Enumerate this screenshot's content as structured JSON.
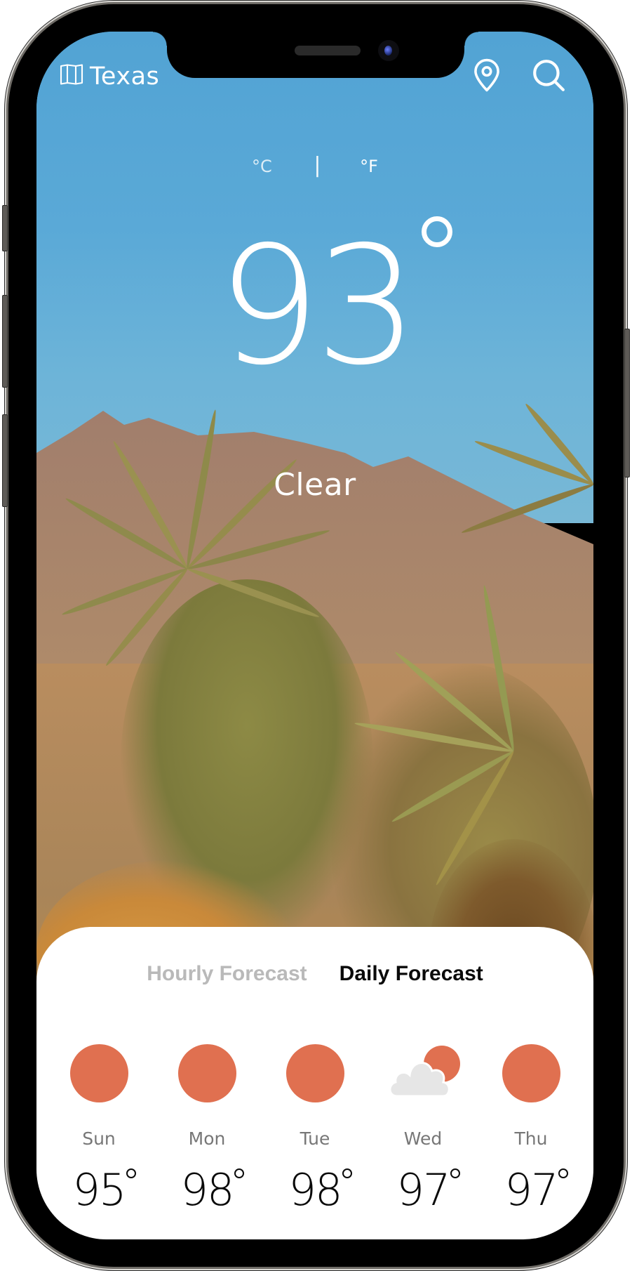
{
  "header": {
    "location": "Texas",
    "location_icon": "map-icon",
    "actions": [
      {
        "name": "location-pin",
        "icon": "map-pin-icon"
      },
      {
        "name": "search",
        "icon": "search-icon"
      }
    ]
  },
  "units": {
    "celsius": "°C",
    "separator": "|",
    "fahrenheit": "°F",
    "selected": "°F"
  },
  "current": {
    "temperature": "93",
    "condition": "Clear"
  },
  "forecast": {
    "tabs": [
      {
        "label": "Hourly Forecast",
        "active": false
      },
      {
        "label": "Daily Forecast",
        "active": true
      }
    ],
    "days": [
      {
        "day": "Sun",
        "temp": "95",
        "icon": "sun-icon"
      },
      {
        "day": "Mon",
        "temp": "98",
        "icon": "sun-icon"
      },
      {
        "day": "Tue",
        "temp": "98",
        "icon": "sun-icon"
      },
      {
        "day": "Wed",
        "temp": "97",
        "icon": "partly-cloudy-icon"
      },
      {
        "day": "Thu",
        "temp": "97",
        "icon": "sun-icon"
      }
    ]
  },
  "colors": {
    "sun": "#e07050",
    "cloud": "#e6e6e6",
    "sky": "#55a4d3",
    "tab_active": "#0a0a0a",
    "tab_inactive": "#b9b9b9"
  }
}
